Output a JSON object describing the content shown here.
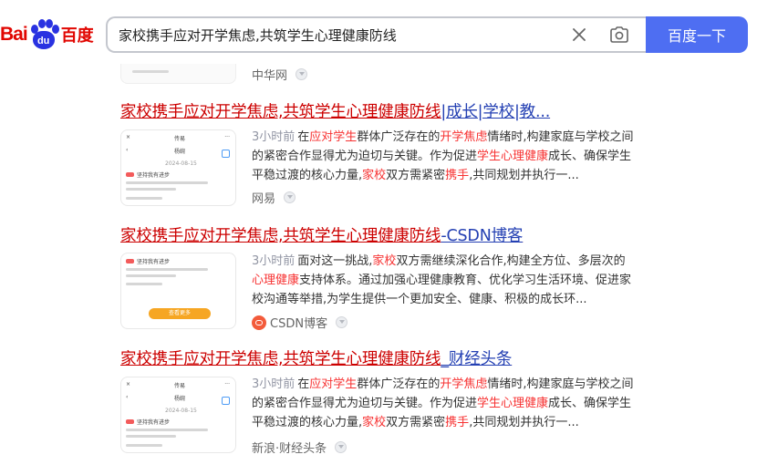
{
  "header": {
    "logo_bai": "Bai",
    "logo_du": "du",
    "logo_cn": "百度",
    "search_value": "家校携手应对开学焦虑,共筑学生心理健康防线",
    "search_button": "百度一下",
    "brand_red": "#e10601",
    "brand_blue": "#4e6ef2"
  },
  "partial": {
    "source": "中华网"
  },
  "results": [
    {
      "title_match": "家校携手应对开学焦虑,共筑学生心理健康防线",
      "title_rest": "|成长|学校|教...",
      "time": "3小时前",
      "snippet_parts": [
        "在",
        "应对学生",
        "群体广泛存在的",
        "开学焦虑",
        "情绪时,构建家庭与学校之间的紧密合作显得尤为迫切与关键。作为促进",
        "学生心理健康",
        "成长、确保学生平稳过渡的核心力量,",
        "家校",
        "双方需紧密",
        "携手",
        ",共同规划并执行一..."
      ],
      "source": "网易",
      "thumb": {
        "top_title": "传易",
        "sub_title": "杨婉",
        "date": "2024-08-15",
        "item": "坚持我有进步",
        "line1": "老师，学习不能光了解成人，我要为了情绪",
        "line2": "已、了、加油vibe"
      }
    },
    {
      "title_match": "家校携手应对开学焦虑,共筑学生心理健康防线",
      "title_rest": "-CSDN博客",
      "time": "3小时前",
      "snippet_parts": [
        "面对这一挑战,",
        "家校",
        "双方需继续深化合作,构建全方位、多层次的",
        "心理健康",
        "支持体系。通过加强心理健康教育、优化学习生活环境、促进家校沟通等举措,为学生提供一个更加安全、健康、积极的成长环..."
      ],
      "source": "CSDN博客",
      "thumb": {
        "item": "坚持我有进步",
        "line1": "老师，学习不能光了解成人，我要为了情绪",
        "line2": "已、了、加油vibe",
        "button": "查看更多"
      }
    },
    {
      "title_match": "家校携手应对开学焦虑,共筑学生心理健康防线",
      "title_rest": "_财经头条",
      "time": "3小时前",
      "snippet_parts": [
        "在",
        "应对学生",
        "群体广泛存在的",
        "开学焦虑",
        "情绪时,构建家庭与学校之间的紧密合作显得尤为迫切与关键。作为促进",
        "学生心理健康",
        "成长、确保学生平稳过渡的核心力量,",
        "家校",
        "双方需紧密",
        "携手",
        ",共同规划并执行一..."
      ],
      "source": "新浪·财经头条",
      "thumb": {
        "top_title": "传易",
        "sub_title": "杨婉",
        "date": "2024-08-15",
        "item": "坚持我有进步",
        "line1": "老师，学习不能光了解成人，我要为了情绪",
        "line2": "已、了、加油vibe"
      }
    }
  ]
}
